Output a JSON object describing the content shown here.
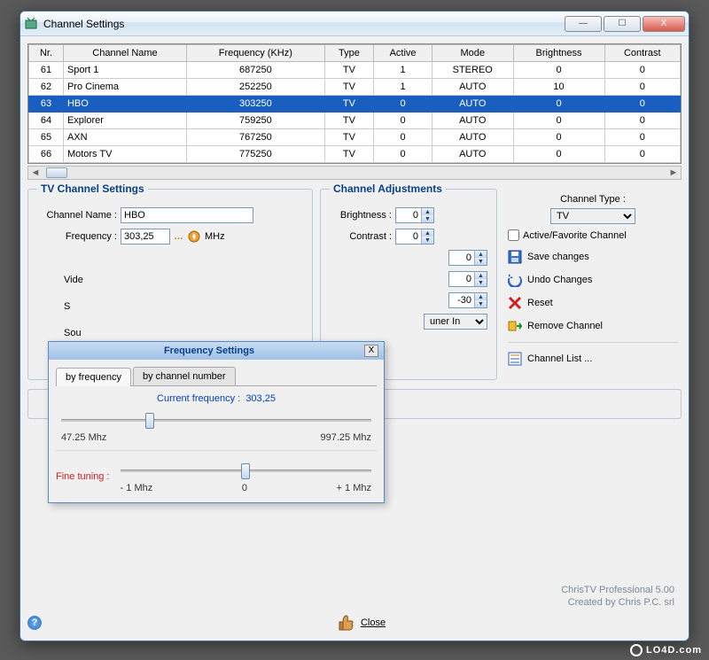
{
  "window": {
    "title": "Channel Settings"
  },
  "winbuttons": {
    "min": "—",
    "max": "☐",
    "close": "X"
  },
  "table": {
    "headers": [
      "Nr.",
      "Channel Name",
      "Frequency (KHz)",
      "Type",
      "Active",
      "Mode",
      "Brightness",
      "Contrast"
    ],
    "rows": [
      {
        "nr": "61",
        "name": "Sport 1",
        "freq": "687250",
        "type": "TV",
        "active": "1",
        "mode": "STEREO",
        "bright": "0",
        "contrast": "0",
        "selected": false
      },
      {
        "nr": "62",
        "name": "Pro Cinema",
        "freq": "252250",
        "type": "TV",
        "active": "1",
        "mode": "AUTO",
        "bright": "10",
        "contrast": "0",
        "selected": false
      },
      {
        "nr": "63",
        "name": "HBO",
        "freq": "303250",
        "type": "TV",
        "active": "0",
        "mode": "AUTO",
        "bright": "0",
        "contrast": "0",
        "selected": true
      },
      {
        "nr": "64",
        "name": "Explorer",
        "freq": "759250",
        "type": "TV",
        "active": "0",
        "mode": "AUTO",
        "bright": "0",
        "contrast": "0",
        "selected": false
      },
      {
        "nr": "65",
        "name": "AXN",
        "freq": "767250",
        "type": "TV",
        "active": "0",
        "mode": "AUTO",
        "bright": "0",
        "contrast": "0",
        "selected": false
      },
      {
        "nr": "66",
        "name": "Motors TV",
        "freq": "775250",
        "type": "TV",
        "active": "0",
        "mode": "AUTO",
        "bright": "0",
        "contrast": "0",
        "selected": false
      }
    ]
  },
  "tv_settings": {
    "legend": "TV Channel Settings",
    "name_label": "Channel Name :",
    "name_value": "HBO",
    "freq_label": "Frequency :",
    "freq_value": "303,25",
    "freq_unit": "MHz",
    "partial_vide": "Vide",
    "partial_s1": "S",
    "partial_sou": "Sou"
  },
  "adjustments": {
    "legend": "Channel Adjustments",
    "brightness_label": "Brightness :",
    "brightness_value": "0",
    "contrast_label": "Contrast :",
    "contrast_value": "0",
    "hidden_a": "0",
    "hidden_b": "0",
    "hidden_c": "-30",
    "input_select": "uner In"
  },
  "right": {
    "type_label": "Channel Type :",
    "type_value": "TV",
    "active_fav": "Active/Favorite Channel",
    "save": "Save changes",
    "undo": "Undo Changes",
    "reset": "Reset",
    "remove": "Remove Channel",
    "channel_list": "Channel List ..."
  },
  "freq_dialog": {
    "title": "Frequency Settings",
    "tab1": "by frequency",
    "tab2": "by channel number",
    "current_label": "Current frequency :",
    "current_value": "303,25",
    "range_min": "47.25 Mhz",
    "range_max": "997.25 Mhz",
    "fine_label": "Fine tuning :",
    "fine_min": "- 1 Mhz",
    "fine_zero": "0",
    "fine_max": "+ 1 Mhz"
  },
  "footer": {
    "close": "Close",
    "app_name": "ChrisTV Professional 5.00",
    "creator": "Created by Chris P.C. srl"
  },
  "watermark": "LO4D.com"
}
